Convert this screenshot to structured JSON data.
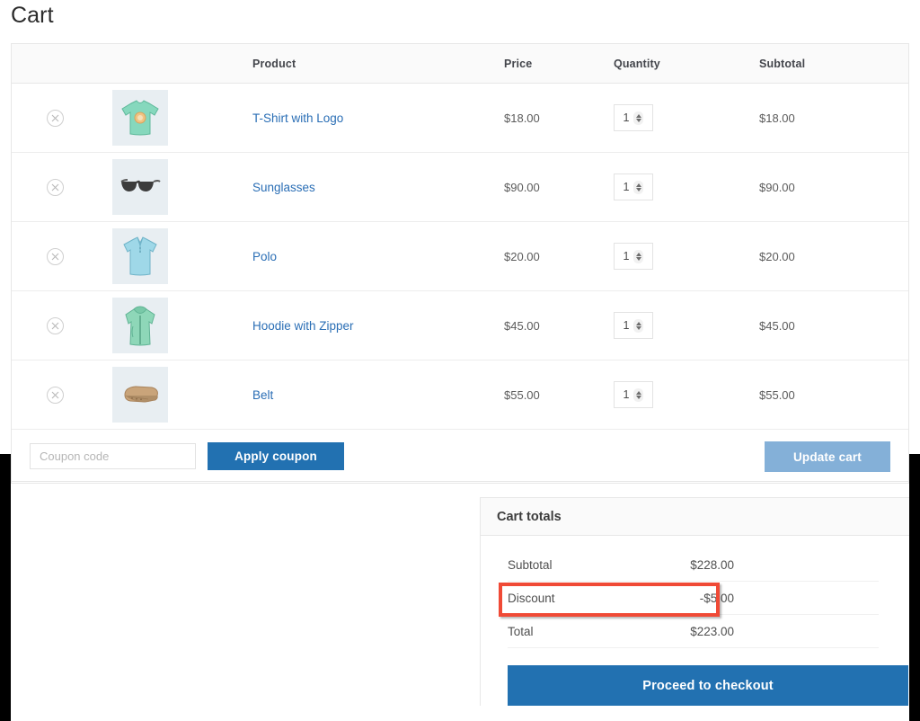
{
  "page": {
    "title": "Cart"
  },
  "table": {
    "headers": {
      "remove": "",
      "thumb": "",
      "product": "Product",
      "price": "Price",
      "quantity": "Quantity",
      "subtotal": "Subtotal"
    },
    "rows": [
      {
        "name": "T-Shirt with Logo",
        "price": "$18.00",
        "qty": "1",
        "subtotal": "$18.00",
        "thumb_icon": "tshirt-thumbnail"
      },
      {
        "name": "Sunglasses",
        "price": "$90.00",
        "qty": "1",
        "subtotal": "$90.00",
        "thumb_icon": "sunglasses-thumbnail"
      },
      {
        "name": "Polo",
        "price": "$20.00",
        "qty": "1",
        "subtotal": "$20.00",
        "thumb_icon": "polo-thumbnail"
      },
      {
        "name": "Hoodie with Zipper",
        "price": "$45.00",
        "qty": "1",
        "subtotal": "$45.00",
        "thumb_icon": "hoodie-thumbnail"
      },
      {
        "name": "Belt",
        "price": "$55.00",
        "qty": "1",
        "subtotal": "$55.00",
        "thumb_icon": "belt-thumbnail"
      }
    ],
    "remove_icon": "remove-item-icon"
  },
  "coupon": {
    "value": "",
    "placeholder": "Coupon code",
    "apply_label": "Apply coupon",
    "update_label": "Update cart"
  },
  "totals": {
    "heading": "Cart totals",
    "lines": [
      {
        "label": "Subtotal",
        "value": "$228.00"
      },
      {
        "label": "Discount",
        "value": "-$5.00"
      },
      {
        "label": "Total",
        "value": "$223.00"
      }
    ],
    "checkout_label": "Proceed to checkout"
  },
  "colors": {
    "link": "#2a6eb5",
    "primary_button": "#2271b1",
    "disabled_button": "#84b0d8",
    "header_bg": "#fafafa",
    "thumb_bg": "#e8eef2",
    "annotation": "#f04a36"
  }
}
